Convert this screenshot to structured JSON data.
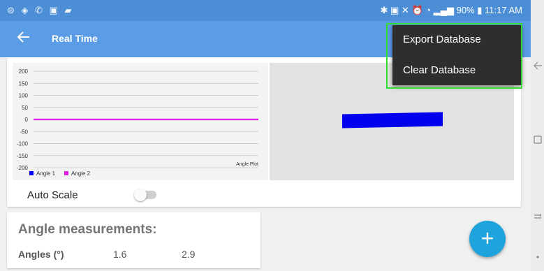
{
  "status_bar": {
    "left_icons": [
      "notification-icon",
      "wifi-call-icon",
      "wifi-icon",
      "image-icon",
      "image2-icon"
    ],
    "right_icons": [
      "bluetooth-icon",
      "nfc-icon",
      "mute-icon",
      "alarm-icon",
      "wifi-icon",
      "signal-icon"
    ],
    "battery": "90%",
    "time": "11:17 AM"
  },
  "app_bar": {
    "title": "Real Time"
  },
  "menu": {
    "items": [
      {
        "label": "Export Database"
      },
      {
        "label": "Clear Database"
      }
    ]
  },
  "chart_data": {
    "type": "line",
    "title": "Angle Plot",
    "xlabel": "",
    "ylabel": "",
    "ylim": [
      -200,
      200
    ],
    "yticks": [
      "200",
      "150",
      "100",
      "50",
      "0",
      "-50",
      "-100",
      "-150",
      "-200"
    ],
    "grid": true,
    "legend_position": "bottom-left",
    "series": [
      {
        "name": "Angle 1",
        "color": "#0000ee",
        "values": [
          0,
          0
        ]
      },
      {
        "name": "Angle 2",
        "color": "#e020e0",
        "values": [
          0,
          0
        ]
      }
    ]
  },
  "visualization": {
    "bar_color": "#0000ee"
  },
  "auto_scale": {
    "label": "Auto Scale",
    "on": false
  },
  "measurements": {
    "title": "Angle measurements:",
    "label": "Angles (°)",
    "value1": "1.6",
    "value2": "2.9"
  },
  "fab": {
    "icon": "plus-icon",
    "label": "+"
  },
  "nav_bar": {
    "icons": [
      "back-icon",
      "recents-icon",
      "recent-apps-icon",
      "home-dot-icon"
    ]
  },
  "colors": {
    "status": "#4c8fd6",
    "app_bar": "#5b9ce6",
    "fab": "#1fa3dc",
    "menu": "#2e2e2e"
  }
}
